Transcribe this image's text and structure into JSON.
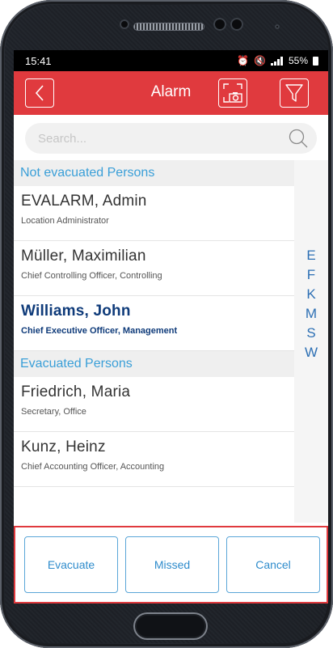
{
  "status_bar": {
    "time": "15:41",
    "battery": "55%"
  },
  "app_bar": {
    "title": "Alarm",
    "icons": [
      "back-icon",
      "scan-photo-icon",
      "filter-icon"
    ]
  },
  "search": {
    "placeholder": "Search..."
  },
  "sections": [
    {
      "title": "Not evacuated Persons",
      "persons": [
        {
          "name": "EVALARM, Admin",
          "role": "Location Administrator"
        },
        {
          "name": "Müller, Maximilian",
          "role": "Chief Controlling Officer, Controlling"
        },
        {
          "name": "Williams, John",
          "role": "Chief Executive Officer, Management",
          "selected": true
        }
      ]
    },
    {
      "title": "Evacuated Persons",
      "persons": [
        {
          "name": "Friedrich, Maria",
          "role": "Secretary, Office"
        },
        {
          "name": "Kunz, Heinz",
          "role": "Chief Accounting Officer, Accounting"
        }
      ]
    }
  ],
  "alphabet_index": [
    "E",
    "F",
    "K",
    "M",
    "S",
    "W"
  ],
  "actions": {
    "evacuate": "Evacuate",
    "missed": "Missed",
    "cancel": "Cancel"
  },
  "colors": {
    "accent": "#e03a3e",
    "section_text": "#3a9fd8",
    "selected_text": "#0f3b7a",
    "button_text": "#2f8ccc"
  }
}
